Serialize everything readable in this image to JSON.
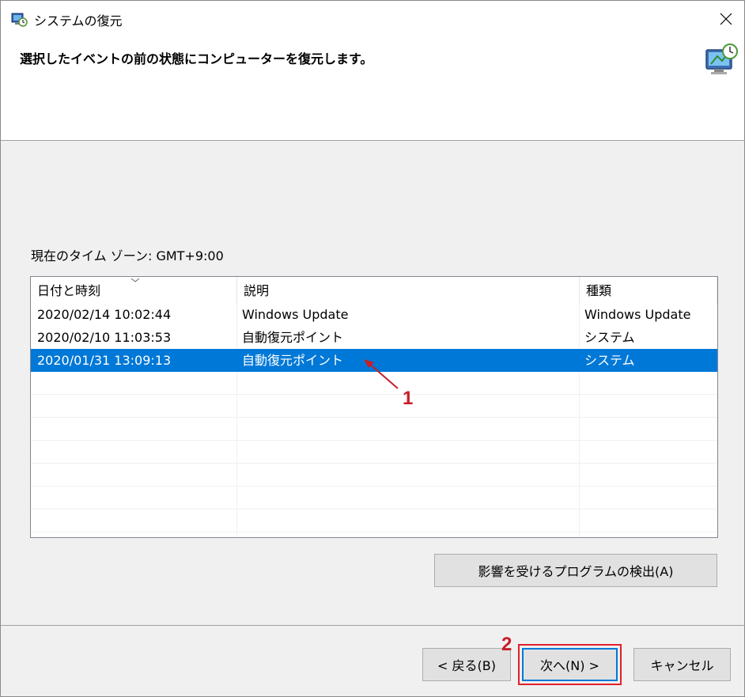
{
  "window": {
    "title": "システムの復元",
    "icons": {
      "app": "system-restore-icon",
      "close": "close-icon",
      "header": "computer-restore-icon"
    }
  },
  "header": {
    "instruction": "選択したイベントの前の状態にコンピューターを復元します。"
  },
  "timezone_label": "現在のタイム ゾーン: GMT+9:00",
  "table": {
    "columns": [
      "日付と時刻",
      "説明",
      "種類"
    ],
    "sort_column": "日付と時刻",
    "rows": [
      {
        "date": "2020/02/14 10:02:44",
        "description": "Windows Update",
        "type": "Windows Update",
        "selected": false
      },
      {
        "date": "2020/02/10 11:03:53",
        "description": "自動復元ポイント",
        "type": "システム",
        "selected": false
      },
      {
        "date": "2020/01/31 13:09:13",
        "description": "自動復元ポイント",
        "type": "システム",
        "selected": true
      }
    ]
  },
  "buttons": {
    "scan": "影響を受けるプログラムの検出(A)",
    "back": "< 戻る(B)",
    "next": "次へ(N) >",
    "cancel": "キャンセル"
  },
  "annotations": {
    "step1": "1",
    "step2": "2"
  },
  "colors": {
    "selection": "#0078d7",
    "annotation": "#c81e28",
    "background": "#f0f0f0"
  }
}
